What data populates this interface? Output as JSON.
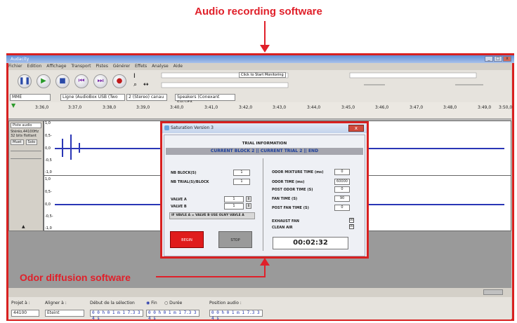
{
  "annotations": {
    "top_label": "Audio recording software",
    "bottom_label": "Odor diffusion software",
    "color": "#e0202a"
  },
  "audacity": {
    "title": "Audacity",
    "menu": [
      "Fichier",
      "Edition",
      "Affichage",
      "Transport",
      "Pistes",
      "Générer",
      "Effets",
      "Analyse",
      "Aide"
    ],
    "meter_button": "Click to Start Monitoring",
    "host": "MME",
    "input_device": "Ligne (AudioBox USB (Two",
    "channels": "2 (Stereo) canau",
    "output_device": "Speakers (Conexant SmartA",
    "timeline_start": "3:36,0",
    "timeline_ticks": [
      "3:37,0",
      "3:38,0",
      "3:39,0",
      "3:40,0",
      "3:41,0",
      "3:42,0",
      "3:43,0",
      "3:44,0",
      "3:45,0",
      "3:46,0",
      "3:47,0",
      "3:48,0",
      "3:49,0",
      "3:50,0"
    ],
    "track": {
      "name": "Piste audio",
      "info1": "Stéréo,44100Hz",
      "info2": "32 bits flottant",
      "mute": "Muet",
      "solo": "Solo",
      "y_ticks_ch1": [
        "1,0",
        "0,5-",
        "0,0",
        "-0,5",
        "-1,0"
      ],
      "y_ticks_ch2": [
        "1,0",
        "0,5-",
        "0,0",
        "-0,5-",
        "-1,0"
      ]
    },
    "selection": {
      "project_label": "Projet à :",
      "project_rate": "44100",
      "snap_label": "Aligner à :",
      "snap_value": "Eteint",
      "start_label": "Début de la sélection",
      "end_radio": "Fin",
      "duration_radio": "Durée",
      "audio_pos_label": "Position audio :",
      "start_value": "0 0 h 0 1 m 1 7.3 3 4 s",
      "end_value": "0 0 h 0 1 m 1 7.3 3 4 s",
      "audio_pos_value": "0 0 h 0 1 m 1 7.3 3 4 s"
    }
  },
  "dialog": {
    "title": "Saturation Version 3",
    "trial_title": "TRIAL INFORMATION",
    "trial_banner": "CURRENT BLOCK 2 || CURRENT TRIAL 2 || END",
    "nb_block_label": "NB BLOCK(S)",
    "nb_block_value": "1",
    "nb_trial_label": "NB TRIAL(S)/BLOCK",
    "nb_trial_value": "1",
    "valve_a_label": "VALVE A",
    "valve_a_value": "1",
    "valve_b_label": "VALVE B",
    "valve_b_value": "1",
    "valve_note": "IF VAVLE A = VALVE B USE OLNY VAVLE A",
    "odor_mixture_label": "ODOR MIXTURE TIME (ms)",
    "odor_mixture_value": "0",
    "odor_time_label": "ODOR TIME (ms)",
    "odor_time_value": "60000",
    "post_odor_label": "POST ODOR TIME (S)",
    "post_odor_value": "0",
    "fan_time_label": "FAN TIME (S)",
    "fan_time_value": "90",
    "post_fan_label": "POST FAN TIME (S)",
    "post_fan_value": "0",
    "exhaust_fan_label": "EXHAUST FAN",
    "clean_air_label": "CLEAN AIR",
    "begin_label": "BEGIN",
    "stop_label": "STOP",
    "timer": "00:02:32"
  }
}
